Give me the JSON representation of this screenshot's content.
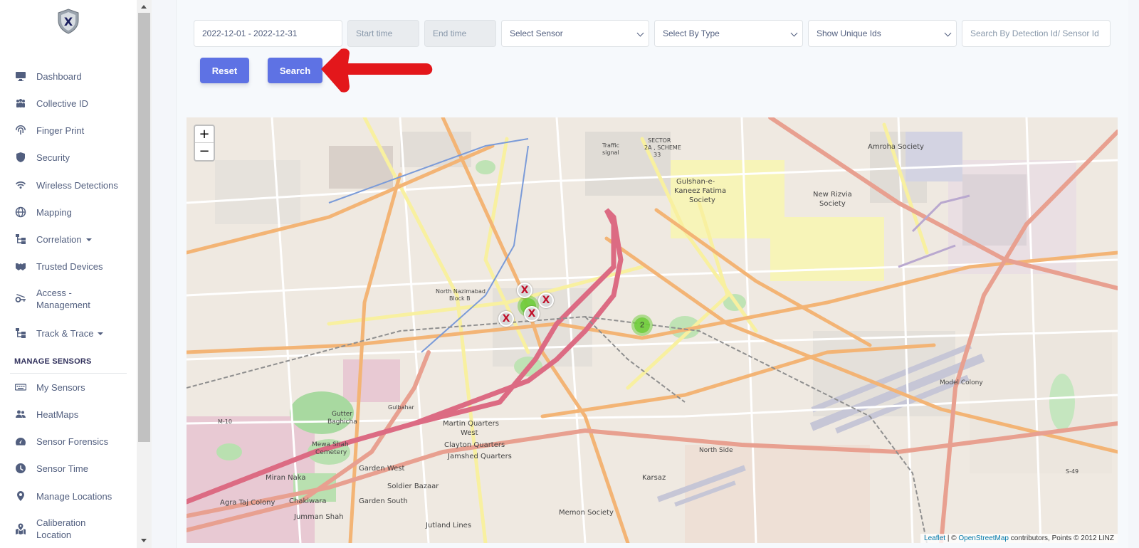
{
  "sidebar": {
    "nav": [
      {
        "label": "Dashboard",
        "icon": "monitor-icon"
      },
      {
        "label": "Collective ID",
        "icon": "users-icon"
      },
      {
        "label": "Finger Print",
        "icon": "fingerprint-icon"
      },
      {
        "label": "Security",
        "icon": "shield-icon"
      },
      {
        "label": "Wireless Detections",
        "icon": "wifi-icon"
      },
      {
        "label": "Mapping",
        "icon": "globe-icon"
      },
      {
        "label": "Correlation",
        "icon": "diagram-icon"
      },
      {
        "label": "Trusted Devices",
        "icon": "handshake-icon"
      },
      {
        "label": "Access -",
        "label2": "Management",
        "icon": "key-icon"
      },
      {
        "label": "Track & Trace",
        "icon": "diagram-icon"
      }
    ],
    "section_title": "MANAGE SENSORS",
    "sensors": [
      {
        "label": "My Sensors",
        "icon": "keyboard-icon"
      },
      {
        "label": "HeatMaps",
        "icon": "user-group-icon"
      },
      {
        "label": "Sensor Forensics",
        "icon": "dashboard-icon"
      },
      {
        "label": "Sensor Time",
        "icon": "clock-icon"
      },
      {
        "label": "Manage Locations",
        "icon": "map-pin-icon"
      },
      {
        "label": "Caliberation",
        "label2": "Location",
        "icon": "map-location-icon"
      }
    ]
  },
  "filters": {
    "date_range": "2022-12-01 - 2022-12-31",
    "start_time_placeholder": "Start time",
    "end_time_placeholder": "End time",
    "sensor_placeholder": "Select Sensor",
    "type_placeholder": "Select By Type",
    "unique_ids_placeholder": "Show Unique Ids",
    "search_placeholder": "Search By Detection Id/ Sensor Id"
  },
  "buttons": {
    "reset": "Reset",
    "search": "Search"
  },
  "map": {
    "zoom_in": "+",
    "zoom_out": "−",
    "cluster_count": "2",
    "marker_glyph": "X",
    "attribution": {
      "leaflet": "Leaflet",
      "sep": " | © ",
      "osm": "OpenStreetMap",
      "rest": " contributors, Points © 2012 LINZ"
    },
    "labels": [
      {
        "text": "Gulshan-e-"
      },
      {
        "text": "Kaneez Fatima"
      },
      {
        "text": "Society"
      },
      {
        "text": "Amroha Society"
      },
      {
        "text": "New Rizvia"
      },
      {
        "text": "Society"
      },
      {
        "text": "Martin Quarters"
      },
      {
        "text": "West"
      },
      {
        "text": "Clayton Quarters"
      },
      {
        "text": "Jamshed Quarters"
      },
      {
        "text": "Garden West"
      },
      {
        "text": "Miran Naka"
      },
      {
        "text": "Soldier Bazaar"
      },
      {
        "text": "Garden South"
      },
      {
        "text": "Chakiwara"
      },
      {
        "text": "Agra Taj Colony"
      },
      {
        "text": "Jumman Shah"
      },
      {
        "text": "Jutland Lines"
      },
      {
        "text": "Memon Society"
      },
      {
        "text": "Karsaz"
      },
      {
        "text": "Mewa Shah"
      },
      {
        "text": "Cemetery"
      },
      {
        "text": "Gutter"
      },
      {
        "text": "Baghicha"
      },
      {
        "text": "North Nazimabad"
      },
      {
        "text": "Block B"
      },
      {
        "text": "SECTOR"
      },
      {
        "text": "2A , SCHEME"
      },
      {
        "text": "33"
      },
      {
        "text": "Traffic"
      },
      {
        "text": "signal"
      },
      {
        "text": "Model Colony"
      },
      {
        "text": "North Side"
      },
      {
        "text": "M-10"
      },
      {
        "text": "S-49"
      },
      {
        "text": "Gulbahar"
      }
    ]
  },
  "colors": {
    "primary": "#5e72e4",
    "arrow": "#e3171b"
  }
}
